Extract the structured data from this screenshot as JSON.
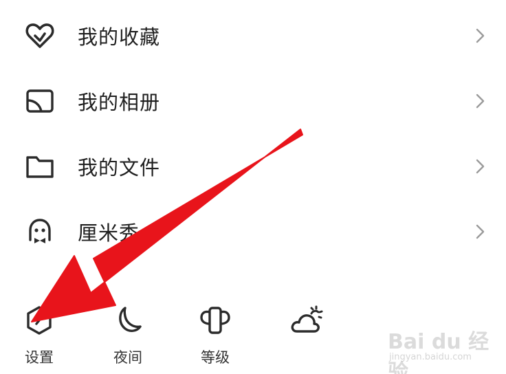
{
  "menu": {
    "items": [
      {
        "label": "我的收藏",
        "icon": "heart-favorites-icon"
      },
      {
        "label": "我的相册",
        "icon": "album-icon"
      },
      {
        "label": "我的文件",
        "icon": "folder-icon"
      },
      {
        "label": "厘米秀",
        "icon": "ghost-avatar-icon"
      }
    ]
  },
  "bottom_bar": {
    "items": [
      {
        "label": "设置",
        "icon": "settings-hexagon-icon"
      },
      {
        "label": "夜间",
        "icon": "moon-icon"
      },
      {
        "label": "等级",
        "icon": "level-crown-icon"
      },
      {
        "label": "",
        "icon": "weather-icon"
      }
    ]
  },
  "annotation": {
    "arrow_color": "#e8141b",
    "points_to": "settings"
  },
  "watermark": {
    "brand": "Bai du 经验",
    "url": "jingyan.baidu.com"
  }
}
